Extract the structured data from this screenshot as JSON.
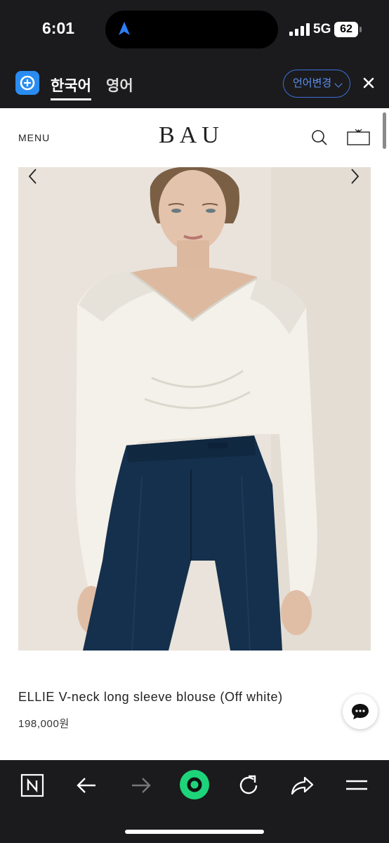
{
  "status_bar": {
    "time": "6:01",
    "network": "5G",
    "battery": "62"
  },
  "translate_bar": {
    "lang_active": "한국어",
    "lang_other": "영어",
    "change_label": "언어변경"
  },
  "site": {
    "menu_label": "MENU",
    "brand": "BAU"
  },
  "product": {
    "name": "ELLIE V-neck long sleeve blouse (Off white)",
    "price": "198,000원"
  },
  "icons": [
    "navigation-arrow-icon",
    "cellular-signal-icon",
    "translate-logo-icon",
    "chevron-down-icon",
    "close-icon",
    "search-icon",
    "shopping-bag-icon",
    "arrow-left-icon",
    "arrow-right-icon",
    "chat-icon",
    "n-logo-icon",
    "back-icon",
    "forward-icon",
    "green-dot-icon",
    "refresh-icon",
    "share-icon",
    "hamburger-menu-icon"
  ],
  "colors": {
    "accent_blue": "#3b6fd9",
    "toolbar_green": "#1ed47a",
    "pants_navy": "#15304c",
    "blouse_white": "#f4f1ea"
  }
}
